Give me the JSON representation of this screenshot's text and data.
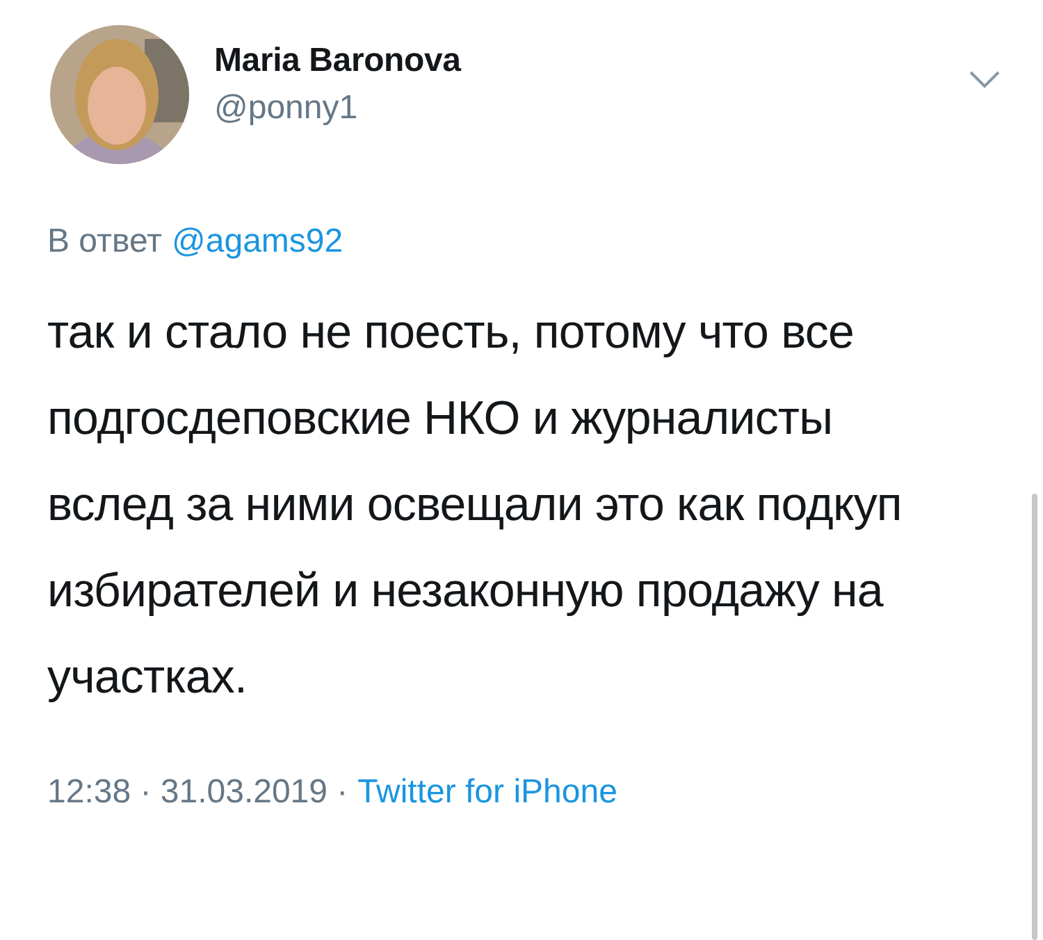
{
  "author": {
    "name": "Maria Baronova",
    "handle": "@ponny1"
  },
  "reply": {
    "label": "В ответ",
    "to": "@agams92"
  },
  "text": "так и стало не поесть, потому что все подгосдеповские НКО и журналисты вслед за ними освещали это как подкуп избирателей и незаконную продажу на участках.",
  "meta": {
    "time": "12:38 · 31.03.2019 ·",
    "source": "Twitter for iPhone"
  }
}
